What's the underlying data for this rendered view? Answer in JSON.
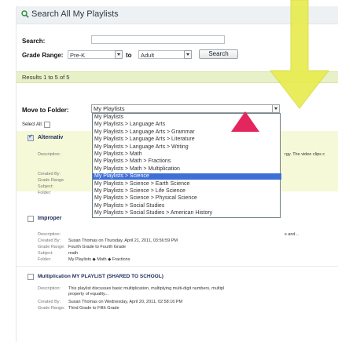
{
  "header": {
    "title": "Search All My Playlists"
  },
  "search": {
    "search_label": "Search:",
    "grade_range_label": "Grade Range:",
    "grade_from": "Pre-K",
    "to_label": "to",
    "grade_to": "Adult",
    "search_button": "Search"
  },
  "results": {
    "text": "Results 1 to 5 of 5"
  },
  "move": {
    "label": "Move to Folder:",
    "selected": "My Playlists",
    "options": [
      "My Playlists",
      "My Playlists > Language Arts",
      "My Playlists > Language Arts > Grammar",
      "My Playlists > Language Arts > Literature",
      "My Playlists > Language Arts > Writing",
      "My Playlists > Math",
      "My Playlists > Math > Fractions",
      "My Playlists > Math > Multiplication",
      "My Playlists > Science",
      "My Playlists > Science > Earth Science",
      "My Playlists > Science > Life Science",
      "My Playlists > Science > Physical Science",
      "My Playlists > Social Studies",
      "My Playlists > Social Studies > American History"
    ],
    "highlighted_index": 8
  },
  "select_all": "Select All:",
  "meta_labels": {
    "description": "Description:",
    "created_by": "Created By:",
    "grade_range": "Grade Range:",
    "subject": "Subject:",
    "folder": "Folder:"
  },
  "items": [
    {
      "title": "Alternativ",
      "description_tail": "rgy. The video clips c",
      "grade_range": "Grade Range",
      "subject": "Subject:",
      "folder": "Folder:"
    },
    {
      "title": "Improper",
      "description_tail": "s and...",
      "created_by": "Susan Thomas on Thursday, April 21, 2011, 03:56:59 PM",
      "grade_range": "Fourth Grade to Fourth Grade",
      "subject": "math",
      "folder": "My Playlists ◆ Math ◆ Fractions"
    },
    {
      "title": "Multiplication  MY PLAYLIST (SHARED TO SCHOOL)",
      "description_line1": "This playlist discusses basic multiplication, multiplying multi-digit numbers, multipl",
      "description_line2": "property of equality...",
      "created_by": "Susan Thomas on Wednesday, April 20, 2011, 02:58:16 PM",
      "grade_range": "Third Grade to Fifth Grade"
    }
  ],
  "colors": {
    "accent_yellow": "#e7ec4c",
    "accent_pink": "#e4265e",
    "results_bar": "#e8f0c8",
    "selected_option": "#3d6fd6"
  }
}
